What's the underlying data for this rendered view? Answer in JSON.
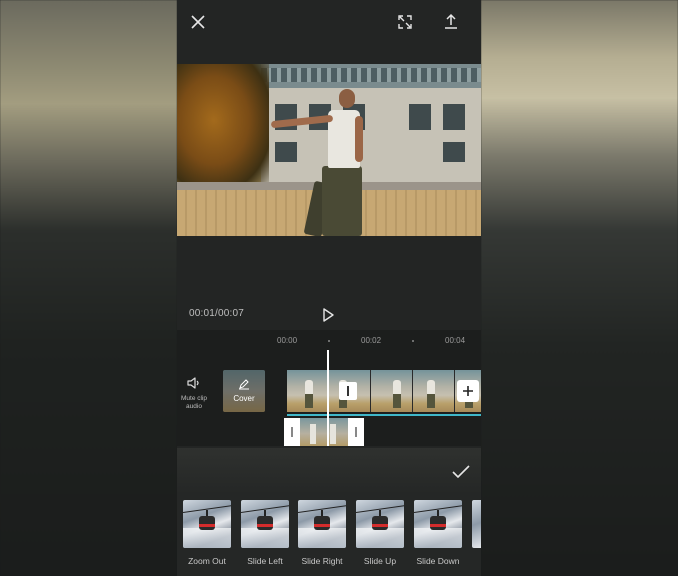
{
  "toolbar": {
    "close_icon": "close-icon",
    "fullscreen_icon": "fullscreen-icon",
    "export_icon": "export-icon"
  },
  "player": {
    "timecode": "00:01/00:07",
    "play_icon": "play-icon"
  },
  "timeline": {
    "ruler_labels": [
      "00:00",
      "00:02",
      "00:04"
    ],
    "mute_label": "Mute clip audio",
    "cover_label": "Cover",
    "add_icon": "plus-icon",
    "accent_color": "#3fb7c9"
  },
  "animations": {
    "confirm_icon": "check-icon",
    "items": [
      {
        "label": "Zoom Out"
      },
      {
        "label": "Slide Left"
      },
      {
        "label": "Slide Right"
      },
      {
        "label": "Slide Up"
      },
      {
        "label": "Slide Down"
      }
    ]
  }
}
